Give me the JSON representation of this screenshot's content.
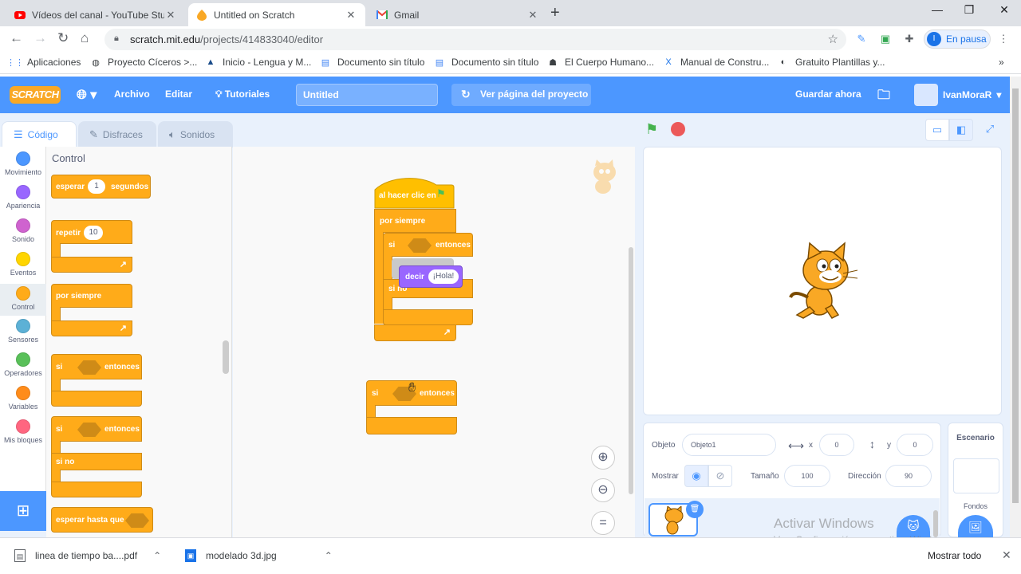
{
  "browser": {
    "tabs": [
      {
        "title": "Vídeos del canal - YouTube Studi",
        "icon": "youtube-icon"
      },
      {
        "title": "Untitled on Scratch",
        "icon": "scratch-icon"
      },
      {
        "title": "Gmail",
        "icon": "gmail-icon"
      }
    ],
    "url_host": "scratch.mit.edu",
    "url_path": "/projects/414833040/editor",
    "profile_initial": "I",
    "profile_label": "En pausa",
    "bookmarks": [
      {
        "label": "Aplicaciones",
        "icon": "apps-grid-icon"
      },
      {
        "label": "Proyecto Cíceros >...",
        "icon": "globe-icon"
      },
      {
        "label": "Inicio - Lengua y M...",
        "icon": "triangle-logo-icon"
      },
      {
        "label": "Documento sin título",
        "icon": "document-icon"
      },
      {
        "label": "Documento sin título",
        "icon": "document-icon"
      },
      {
        "label": "El Cuerpo Humano...",
        "icon": "body-icon"
      },
      {
        "label": "Manual de Constru...",
        "icon": "x-logo-icon"
      },
      {
        "label": "Gratuito Plantillas y...",
        "icon": "template-icon"
      }
    ]
  },
  "scratch": {
    "logo": "SCRATCH",
    "menu": {
      "archivo": "Archivo",
      "editar": "Editar",
      "tutoriales": "Tutoriales",
      "project_title": "Untitled",
      "see_project": "Ver página del proyecto",
      "save_now": "Guardar ahora",
      "username": "IvanMoraR"
    },
    "editor_tabs": [
      "Código",
      "Disfraces",
      "Sonidos"
    ],
    "categories": [
      {
        "label": "Movimiento",
        "color": "#4c97ff"
      },
      {
        "label": "Apariencia",
        "color": "#9966ff"
      },
      {
        "label": "Sonido",
        "color": "#cf63cf"
      },
      {
        "label": "Eventos",
        "color": "#ffd500"
      },
      {
        "label": "Control",
        "color": "#ffab19"
      },
      {
        "label": "Sensores",
        "color": "#5cb1d6"
      },
      {
        "label": "Operadores",
        "color": "#59c059"
      },
      {
        "label": "Variables",
        "color": "#ff8c1a"
      },
      {
        "label": "Mis bloques",
        "color": "#ff6680"
      }
    ],
    "palette": {
      "heading": "Control",
      "wait": {
        "label": "esperar",
        "value": "1",
        "suffix": "segundos"
      },
      "repeat": {
        "label": "repetir",
        "value": "10"
      },
      "forever": "por siempre",
      "if_then": {
        "if": "si",
        "then": "entonces"
      },
      "if_else": {
        "if": "si",
        "then": "entonces",
        "else": "si no"
      },
      "wait_until": "esperar hasta que"
    },
    "script": {
      "hat": "al hacer clic en",
      "forever": "por siempre",
      "if": "si",
      "then": "entonces",
      "else": "si no",
      "say": "decir",
      "say_value": "¡Hola!"
    },
    "loose_block": {
      "if": "si",
      "then": "entonces"
    },
    "sprite_info": {
      "sprite_label": "Objeto",
      "sprite_name": "Objeto1",
      "x_label": "x",
      "x_value": "0",
      "y_label": "y",
      "y_value": "0",
      "show_label": "Mostrar",
      "size_label": "Tamaño",
      "size_value": "100",
      "direction_label": "Dirección",
      "direction_value": "90"
    },
    "stage_panel": {
      "title": "Escenario",
      "backdrops_label": "Fondos"
    }
  },
  "windows_watermark": {
    "title": "Activar Windows",
    "subtitle": "Ve a Configuración para activar Windows."
  },
  "downloads": {
    "items": [
      {
        "name": "linea de tiempo ba....pdf",
        "icon": "pdf-file-icon"
      },
      {
        "name": "modelado 3d.jpg",
        "icon": "image-file-icon"
      }
    ],
    "show_all": "Mostrar todo"
  }
}
